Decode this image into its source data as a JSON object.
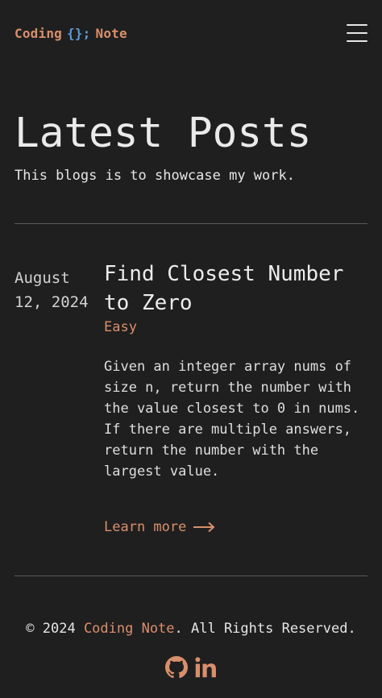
{
  "header": {
    "logo_left": "Coding",
    "logo_braces": "{};",
    "logo_right": "Note",
    "menu_icon": "hamburger-menu-icon"
  },
  "hero": {
    "title": "Latest Posts",
    "subtitle": "This blogs is to showcase my work."
  },
  "posts": [
    {
      "date_line1": "August",
      "date_line2": "12, 2024",
      "title": "Find Closest Number to Zero",
      "tag": "Easy",
      "excerpt": "Given an integer array nums of size n, return the number with the value closest to 0 in nums. If there are multiple answers, return the number with the largest value.",
      "learn_more": "Learn more"
    }
  ],
  "footer": {
    "prefix": "© 2024 ",
    "brand": "Coding Note",
    "suffix": ". All Rights Reserved.",
    "social_icons": [
      "github-icon",
      "linkedin-icon"
    ]
  },
  "colors": {
    "background": "#1f1f1f",
    "accent": "#d98f6c",
    "braces": "#5c9bd6",
    "text": "#e6e6e6",
    "divider": "#5a5a5a"
  }
}
